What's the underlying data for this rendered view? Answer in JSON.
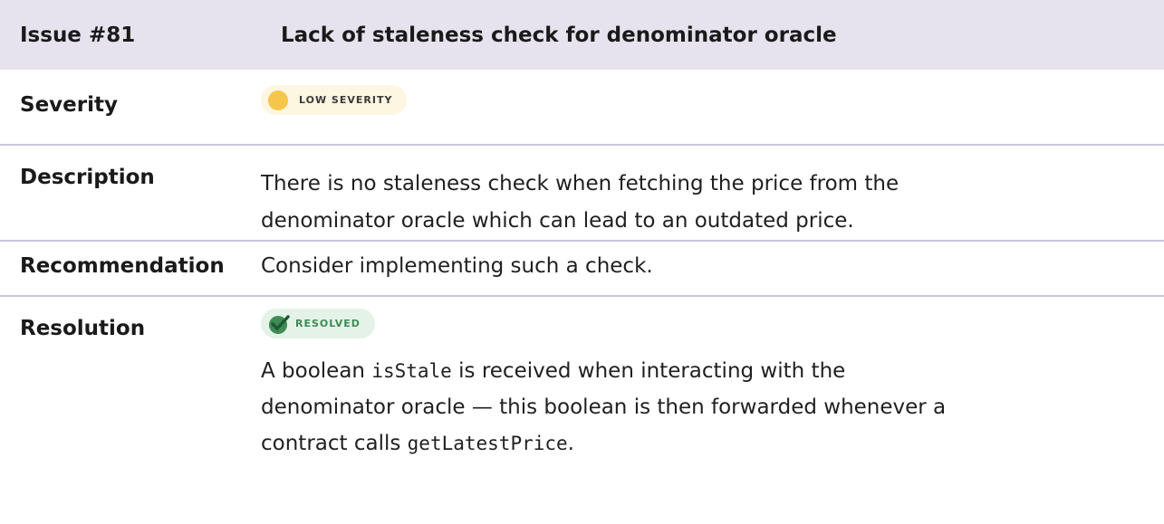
{
  "issue": {
    "number_label": "Issue #81",
    "title": "Lack of staleness check for denominator oracle"
  },
  "severity": {
    "label": "Severity",
    "badge_text": "LOW SEVERITY",
    "badge_color": "#f6c64a"
  },
  "description": {
    "label": "Description",
    "line1": "There is no staleness check when fetching the price from the",
    "line2": "denominator oracle which can lead to an outdated price."
  },
  "recommendation": {
    "label": "Recommendation",
    "text": "Consider implementing such a check."
  },
  "resolution": {
    "label": "Resolution",
    "badge_text": "RESOLVED",
    "badge_color": "#3f8a55",
    "text_part1": "A boolean ",
    "code1": "isStale",
    "text_part2": " is received when interacting with the",
    "text_part3": "denominator oracle — this boolean is then forwarded whenever a",
    "text_part4": "contract calls ",
    "code2": "getLatestPrice",
    "text_part5": "."
  }
}
